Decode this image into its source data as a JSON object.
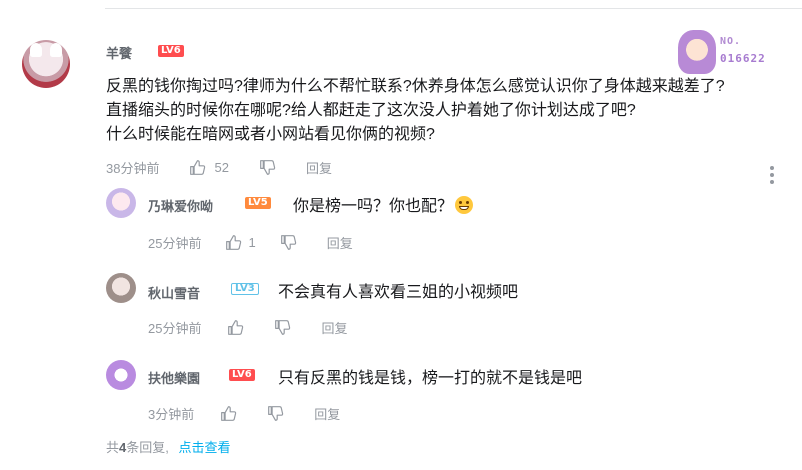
{
  "main_comment": {
    "username": "羊餮",
    "level": "LV6",
    "badge": {
      "label": "NO.",
      "number": "016622"
    },
    "lines": [
      "反黑的钱你掏过吗?律师为什么不帮忙联系?休养身体怎么感觉认识你了身体越来越差了?",
      "直播缩头的时候你在哪呢?给人都赶走了这次没人护着她了你计划达成了吧?",
      "什么时候能在暗网或者小网站看见你俩的视频?"
    ],
    "time": "38分钟前",
    "likes": "52",
    "reply_label": "回复"
  },
  "replies": [
    {
      "username": "乃琳爱你呦",
      "level": "LV5",
      "text": "你是榜一吗？你也配？",
      "emoji": "grin-emoji",
      "time": "25分钟前",
      "likes": "1",
      "reply_label": "回复"
    },
    {
      "username": "秋山雪音",
      "level": "LV3",
      "text": "不会真有人喜欢看三姐的小视频吧",
      "time": "25分钟前",
      "likes": "",
      "reply_label": "回复"
    },
    {
      "username": "扶他樂園",
      "level": "LV6",
      "text": "只有反黑的钱是钱，榜一打的就不是钱是吧",
      "time": "3分钟前",
      "likes": "",
      "reply_label": "回复"
    }
  ],
  "footer": {
    "prefix": "共",
    "count": "4",
    "suffix": "条回复,",
    "link": "点击查看"
  },
  "colors": {
    "lv6": "#ff4d4f",
    "lv5": "#ff8a3d",
    "lv3": "#61c2e8",
    "link": "#00aeec",
    "meta": "#9499a0"
  }
}
